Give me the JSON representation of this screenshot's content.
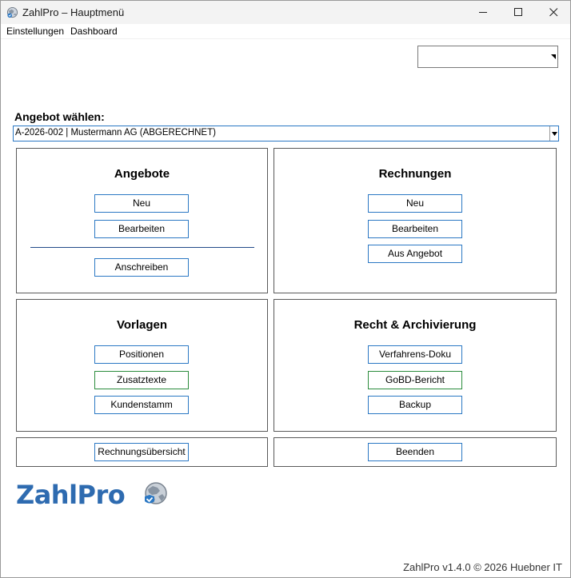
{
  "window": {
    "title": "ZahlPro – Hauptmenü"
  },
  "menu": {
    "items": [
      "Einstellungen",
      "Dashboard"
    ]
  },
  "top_selector": {
    "value": ""
  },
  "offer_select": {
    "label": "Angebot wählen:",
    "value": "A-2026-002 | Mustermann AG (ABGERECHNET)"
  },
  "panels": {
    "angebote": {
      "title": "Angebote",
      "buttons": [
        "Neu",
        "Bearbeiten",
        "Anschreiben"
      ]
    },
    "rechnungen": {
      "title": "Rechnungen",
      "buttons": [
        "Neu",
        "Bearbeiten",
        "Aus Angebot"
      ]
    },
    "vorlagen": {
      "title": "Vorlagen",
      "buttons": [
        "Positionen",
        "Zusatztexte",
        "Kundenstamm"
      ]
    },
    "recht": {
      "title": "Recht & Archivierung",
      "buttons": [
        "Verfahrens-Doku",
        "GoBD-Bericht",
        "Backup"
      ]
    },
    "bottom_left": {
      "button": "Rechnungsübersicht"
    },
    "bottom_right": {
      "button": "Beenden"
    }
  },
  "logo": {
    "text": "ZahlPro"
  },
  "footer": {
    "text": "ZahlPro v1.4.0 © 2026 Huebner IT"
  },
  "colors": {
    "accent": "#2b78c4",
    "logo": "#2e6bb0",
    "green": "#2b8c3c"
  }
}
